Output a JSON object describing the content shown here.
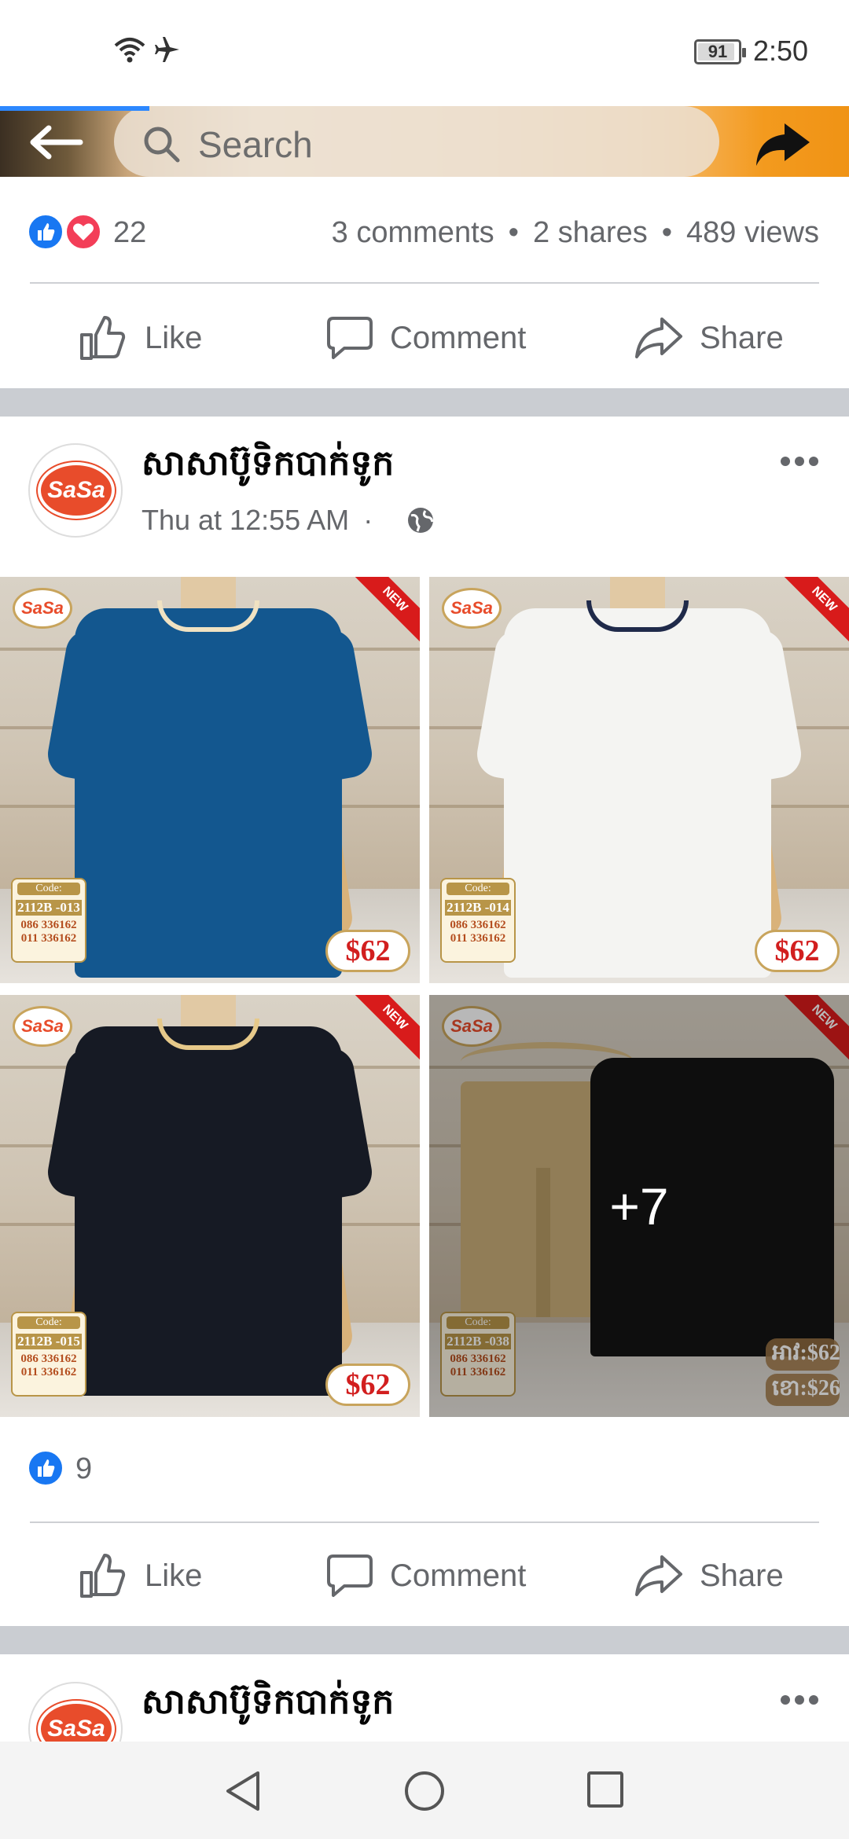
{
  "status_bar": {
    "battery": "91",
    "time": "2:50",
    "icons": [
      "wifi-icon",
      "airplane-icon",
      "battery-icon"
    ]
  },
  "header": {
    "search_placeholder": "Search",
    "icons": [
      "back-arrow-icon",
      "search-icon",
      "share-arrow-icon"
    ]
  },
  "post1": {
    "reaction_count": "22",
    "comments": "3 comments",
    "shares": "2 shares",
    "views": "489 views",
    "separator_dot": "•"
  },
  "actions": {
    "like": "Like",
    "comment": "Comment",
    "share": "Share"
  },
  "post2": {
    "page_name": "សាសាប៊ូទិកបាក់ទូក",
    "time": "Thu at 12:55 AM",
    "time_separator": "·",
    "more_photos": "+7",
    "like_count": "9",
    "avatar_text": "SaSa",
    "photos": [
      {
        "code_label": "Code:",
        "code": "2112B -013",
        "phone1": "086 336162",
        "phone2": "011 336162",
        "price": "$62",
        "badge": "NEW",
        "shirt_color": "#13578f",
        "collar_color": "#f0e2c2"
      },
      {
        "code_label": "Code:",
        "code": "2112B -014",
        "phone1": "086 336162",
        "phone2": "011 336162",
        "price": "$62",
        "badge": "NEW",
        "shirt_color": "#f4f4f2",
        "collar_color": "#1f2a4a"
      },
      {
        "code_label": "Code:",
        "code": "2112B -015",
        "phone1": "086 336162",
        "phone2": "011 336162",
        "price": "$62",
        "badge": "NEW",
        "shirt_color": "#161a24",
        "collar_color": "#e6c98a"
      },
      {
        "code_label": "Code:",
        "code": "2112B -038",
        "phone1": "086 336162",
        "phone2": "011 336162",
        "price_top": "អាវ:$62",
        "price_bottom": "ខោ:$26",
        "badge": "NEW"
      }
    ]
  },
  "post3": {
    "page_name": "សាសាប៊ូទិកបាក់ទូក",
    "avatar_text": "SaSa"
  },
  "colors": {
    "facebook_blue": "#1877f2",
    "love_red": "#f33e58",
    "secondary_text": "#65676b",
    "separator_gray": "#cacdd2"
  }
}
